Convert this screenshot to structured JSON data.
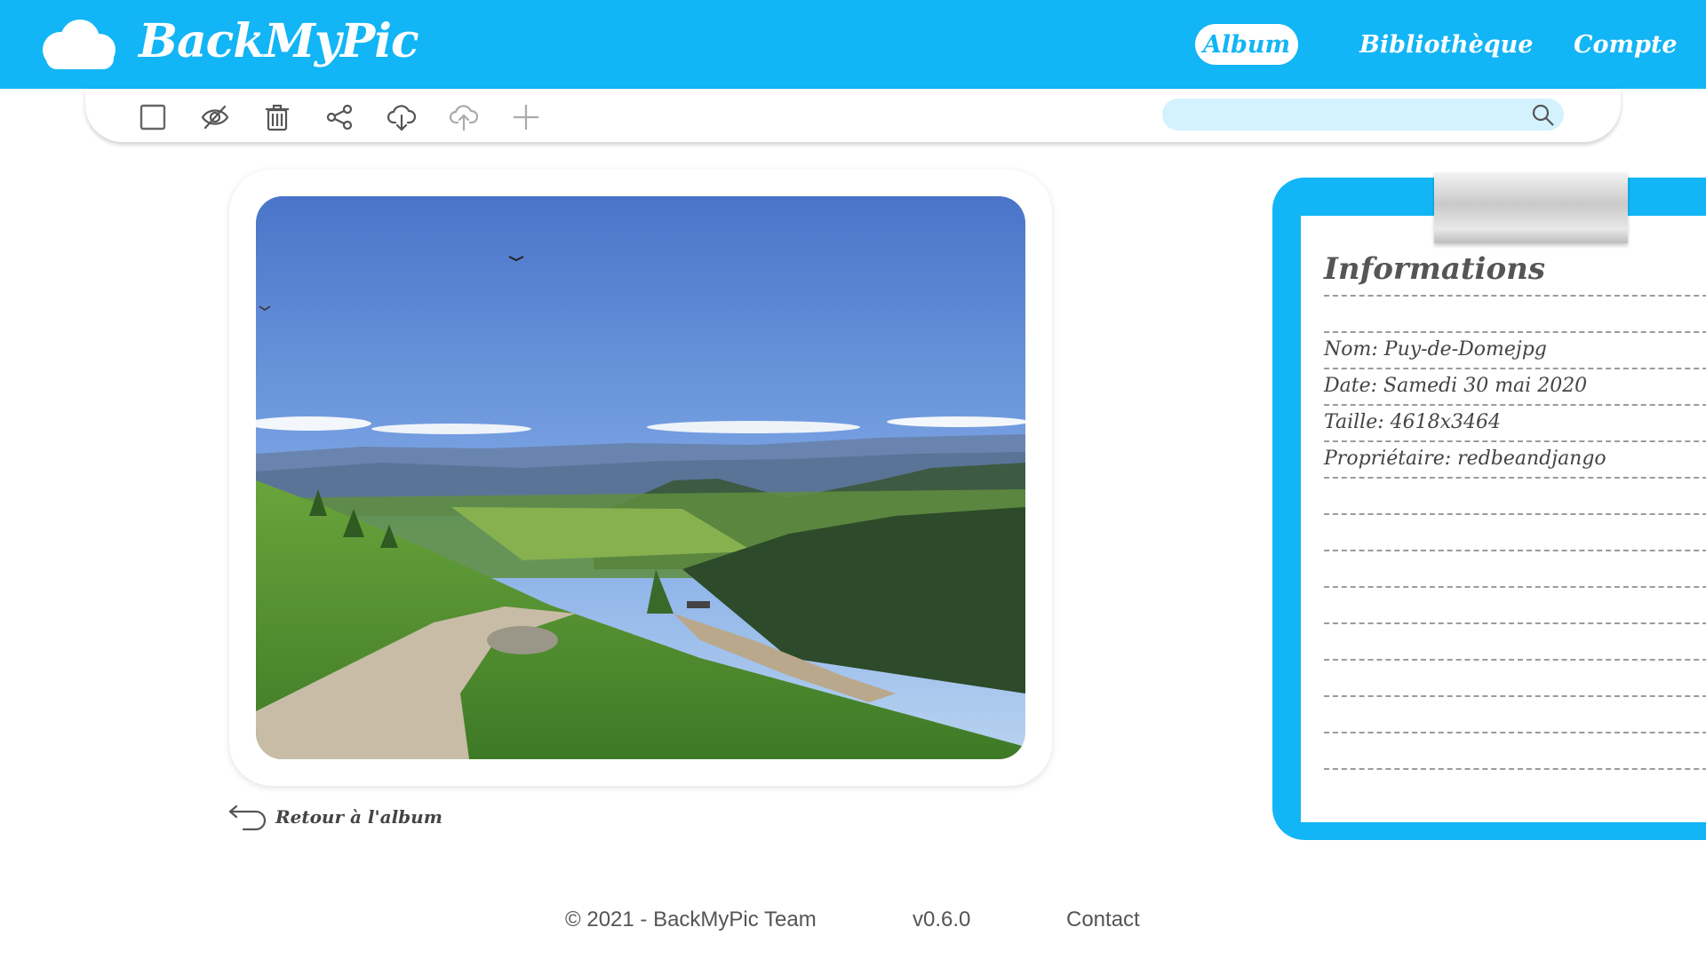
{
  "app": {
    "title": "BackMyPic",
    "brand_color": "#12b5f5"
  },
  "nav": {
    "album": "Album",
    "bibliotheque": "Bibliothèque",
    "compte": "Compte"
  },
  "toolbar": {
    "icons": [
      "checkbox-icon",
      "eye-slash-icon",
      "trash-icon",
      "share-icon",
      "cloud-download-icon",
      "cloud-upload-icon",
      "plus-icon"
    ],
    "search_placeholder": ""
  },
  "photo": {
    "description_icon": "landscape-photo"
  },
  "back": {
    "label": "Retour à l'album"
  },
  "info": {
    "title": "Informations",
    "nom": "Nom: Puy-de-Domejpg",
    "date": "Date: Samedi 30 mai 2020",
    "taille": "Taille: 4618x3464",
    "proprietaire": "Propriétaire: redbeandjango"
  },
  "footer": {
    "copyright": "© 2021 - BackMyPic Team",
    "version": "v0.6.0",
    "contact": "Contact"
  }
}
